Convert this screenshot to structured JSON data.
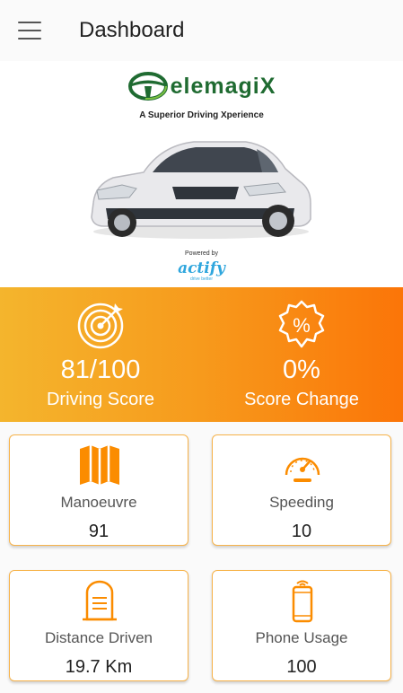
{
  "appbar": {
    "title": "Dashboard",
    "menu_icon": "hamburger-menu-icon"
  },
  "brand": {
    "logo_text": "elemagiX",
    "logo_icon": "steering-wheel-icon",
    "tagline": "A Superior Driving Xperience",
    "powered_by": "Powered by",
    "partner": "actify",
    "partner_sub": "drive better",
    "car_image": "white-sedan-car"
  },
  "score": {
    "driving_score": {
      "value": "81/100",
      "label": "Driving Score",
      "icon": "target-icon"
    },
    "score_change": {
      "value": "0%",
      "label": "Score Change",
      "icon": "percent-badge-icon"
    }
  },
  "cards": {
    "manoeuvre": {
      "label": "Manoeuvre",
      "value": "91",
      "icon": "map-icon"
    },
    "speeding": {
      "label": "Speeding",
      "value": "10",
      "icon": "speedometer-icon"
    },
    "distance": {
      "label": "Distance Driven",
      "value": "19.7 Km",
      "icon": "mailbox-icon"
    },
    "phone": {
      "label": "Phone Usage",
      "value": "100",
      "icon": "phone-icon"
    }
  },
  "colors": {
    "accent": "#fb8c00",
    "gradient_start": "#f4b52d",
    "gradient_end": "#fb7508",
    "brand_green": "#1f6b31",
    "partner_blue": "#2fa6dd"
  }
}
